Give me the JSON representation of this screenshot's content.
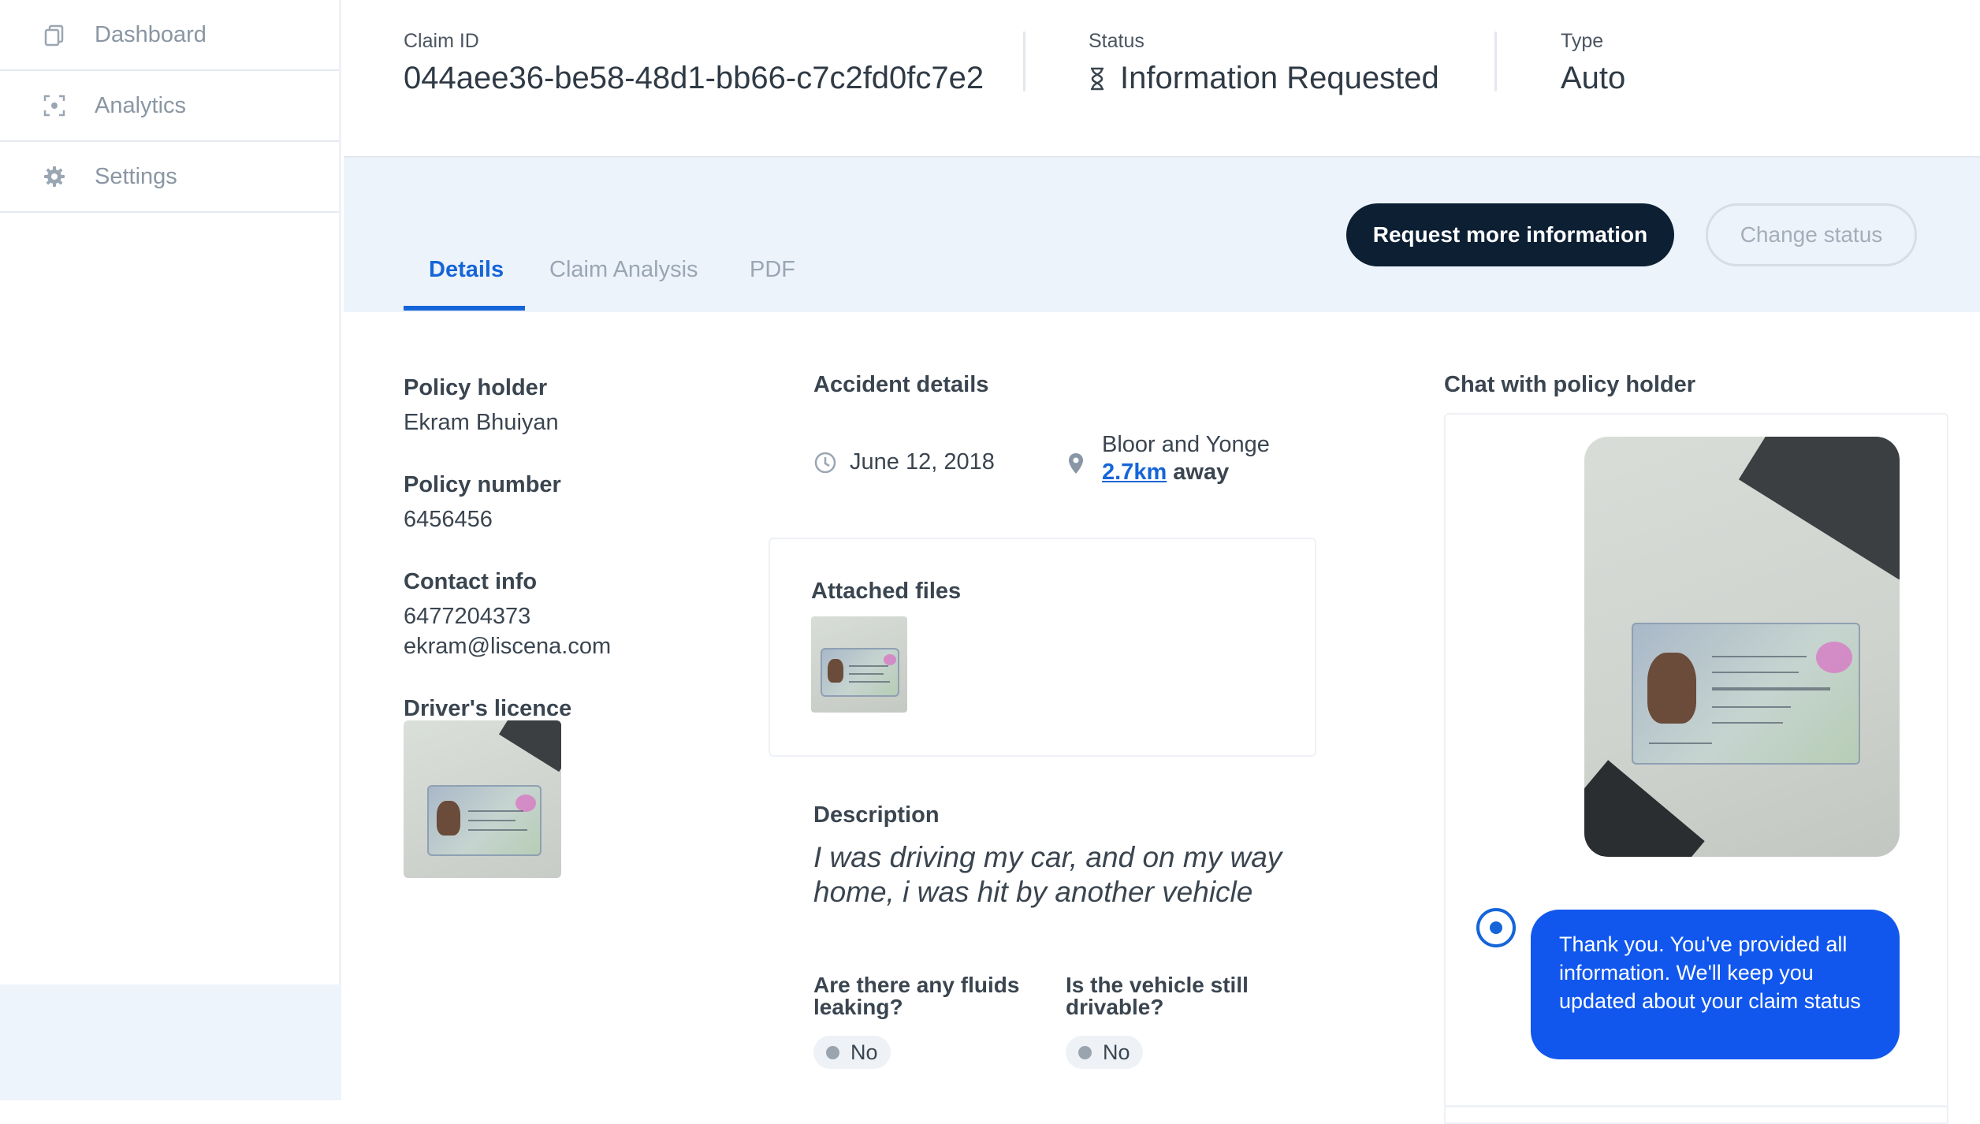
{
  "sidebar": {
    "items": [
      {
        "label": "Dashboard",
        "icon": "copy-icon"
      },
      {
        "label": "Analytics",
        "icon": "analytics-icon"
      },
      {
        "label": "Settings",
        "icon": "gear-icon"
      }
    ]
  },
  "header": {
    "claim_id_label": "Claim ID",
    "claim_id_value": "044aee36-be58-48d1-bb66-c7c2fd0fc7e2",
    "status_label": "Status",
    "status_value": "Information Requested",
    "status_icon": "hourglass-icon",
    "type_label": "Type",
    "type_value": "Auto"
  },
  "tabs": [
    {
      "label": "Details",
      "active": true
    },
    {
      "label": "Claim Analysis",
      "active": false
    },
    {
      "label": "PDF",
      "active": false
    }
  ],
  "actions": {
    "request_more_info": "Request more information",
    "change_status": "Change status"
  },
  "policy": {
    "holder_label": "Policy holder",
    "holder_value": "Ekram Bhuiyan",
    "number_label": "Policy number",
    "number_value": "6456456",
    "contact_label": "Contact info",
    "phone": "6477204373",
    "email": "ekram@liscena.com",
    "licence_label": "Driver's licence"
  },
  "accident": {
    "title": "Accident details",
    "date": "June 12, 2018",
    "location": "Bloor and Yonge",
    "distance": "2.7km",
    "distance_suffix": "away",
    "attached_files_label": "Attached files",
    "description_label": "Description",
    "description": "I was driving my car, and on my way home, i was hit by another vehicle",
    "q_fluids": "Are there any fluids leaking?",
    "a_fluids": "No",
    "q_drivable": "Is the vehicle still drivable?",
    "a_drivable": "No"
  },
  "chat": {
    "title": "Chat with policy holder",
    "message": "Thank you. You've provided all information. We'll keep you updated about your claim status"
  },
  "colors": {
    "accent": "#1565d8",
    "primary_button": "#0c1f33",
    "chat_bubble": "#1157ee",
    "band": "#edf3fb"
  }
}
